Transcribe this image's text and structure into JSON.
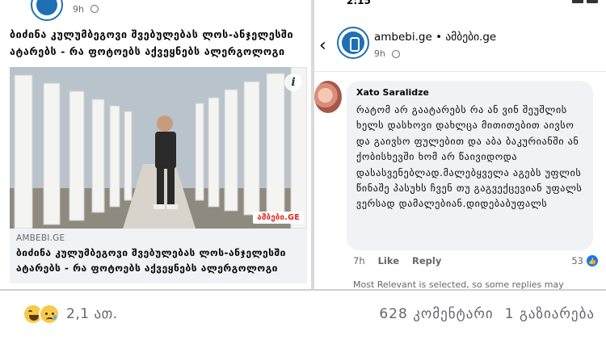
{
  "left_post": {
    "time": "9h",
    "headline": "ბიძინა კულუმბეგოვი შვებულებას ლოს-ანჯელესში ატარებს - რა ფოტოებს აქვეყნებს ალერგოლოგი",
    "photo_badge": "ამბები.GE",
    "info_icon": "i",
    "link_source": "AMBEBI.GE",
    "link_title": "ბიძინა კულუმბეგოვი შვებულებას ლოს-ანჯელესში ატარებს - რა ფოტოებს აქვეყნებს ალერგოლოგი"
  },
  "right_post": {
    "status_time": "2:15",
    "back_icon": "‹",
    "page_name": "ambebi.ge • ამბები.ge",
    "time": "9h",
    "comment": {
      "author": "Xato Saralidze",
      "text": "რატომ არ გაატარებს რა ან ვინ შეუშლის ხელს დასხოვი დახლცა მითითებით აივსო და გაივსო ფულებით და აბა ბაკურიანში ან ქობისხევში ხომ არ წაივიდოდა დასასვენებლად.მალებყველა აგებს უფლის წინაშე პასუხს ჩვენ თუ გაგვექცევიან უფალს ვერსად დამალებიან.დიდებაბუფალს",
      "time": "7h",
      "like_label": "Like",
      "reply_label": "Reply",
      "like_count": "53"
    },
    "relevance_note": "Most Relevant is selected, so some replies may"
  },
  "bottom_bar": {
    "reaction_count": "2,1 ათ.",
    "comments": "628 კომენტარი",
    "shares": "1 გაზიარება"
  },
  "colors": {
    "brand_blue": "#1f6fb5",
    "like_blue": "#1877f2",
    "bubble_bg": "#f0f2f5",
    "muted_text": "#65676b"
  }
}
